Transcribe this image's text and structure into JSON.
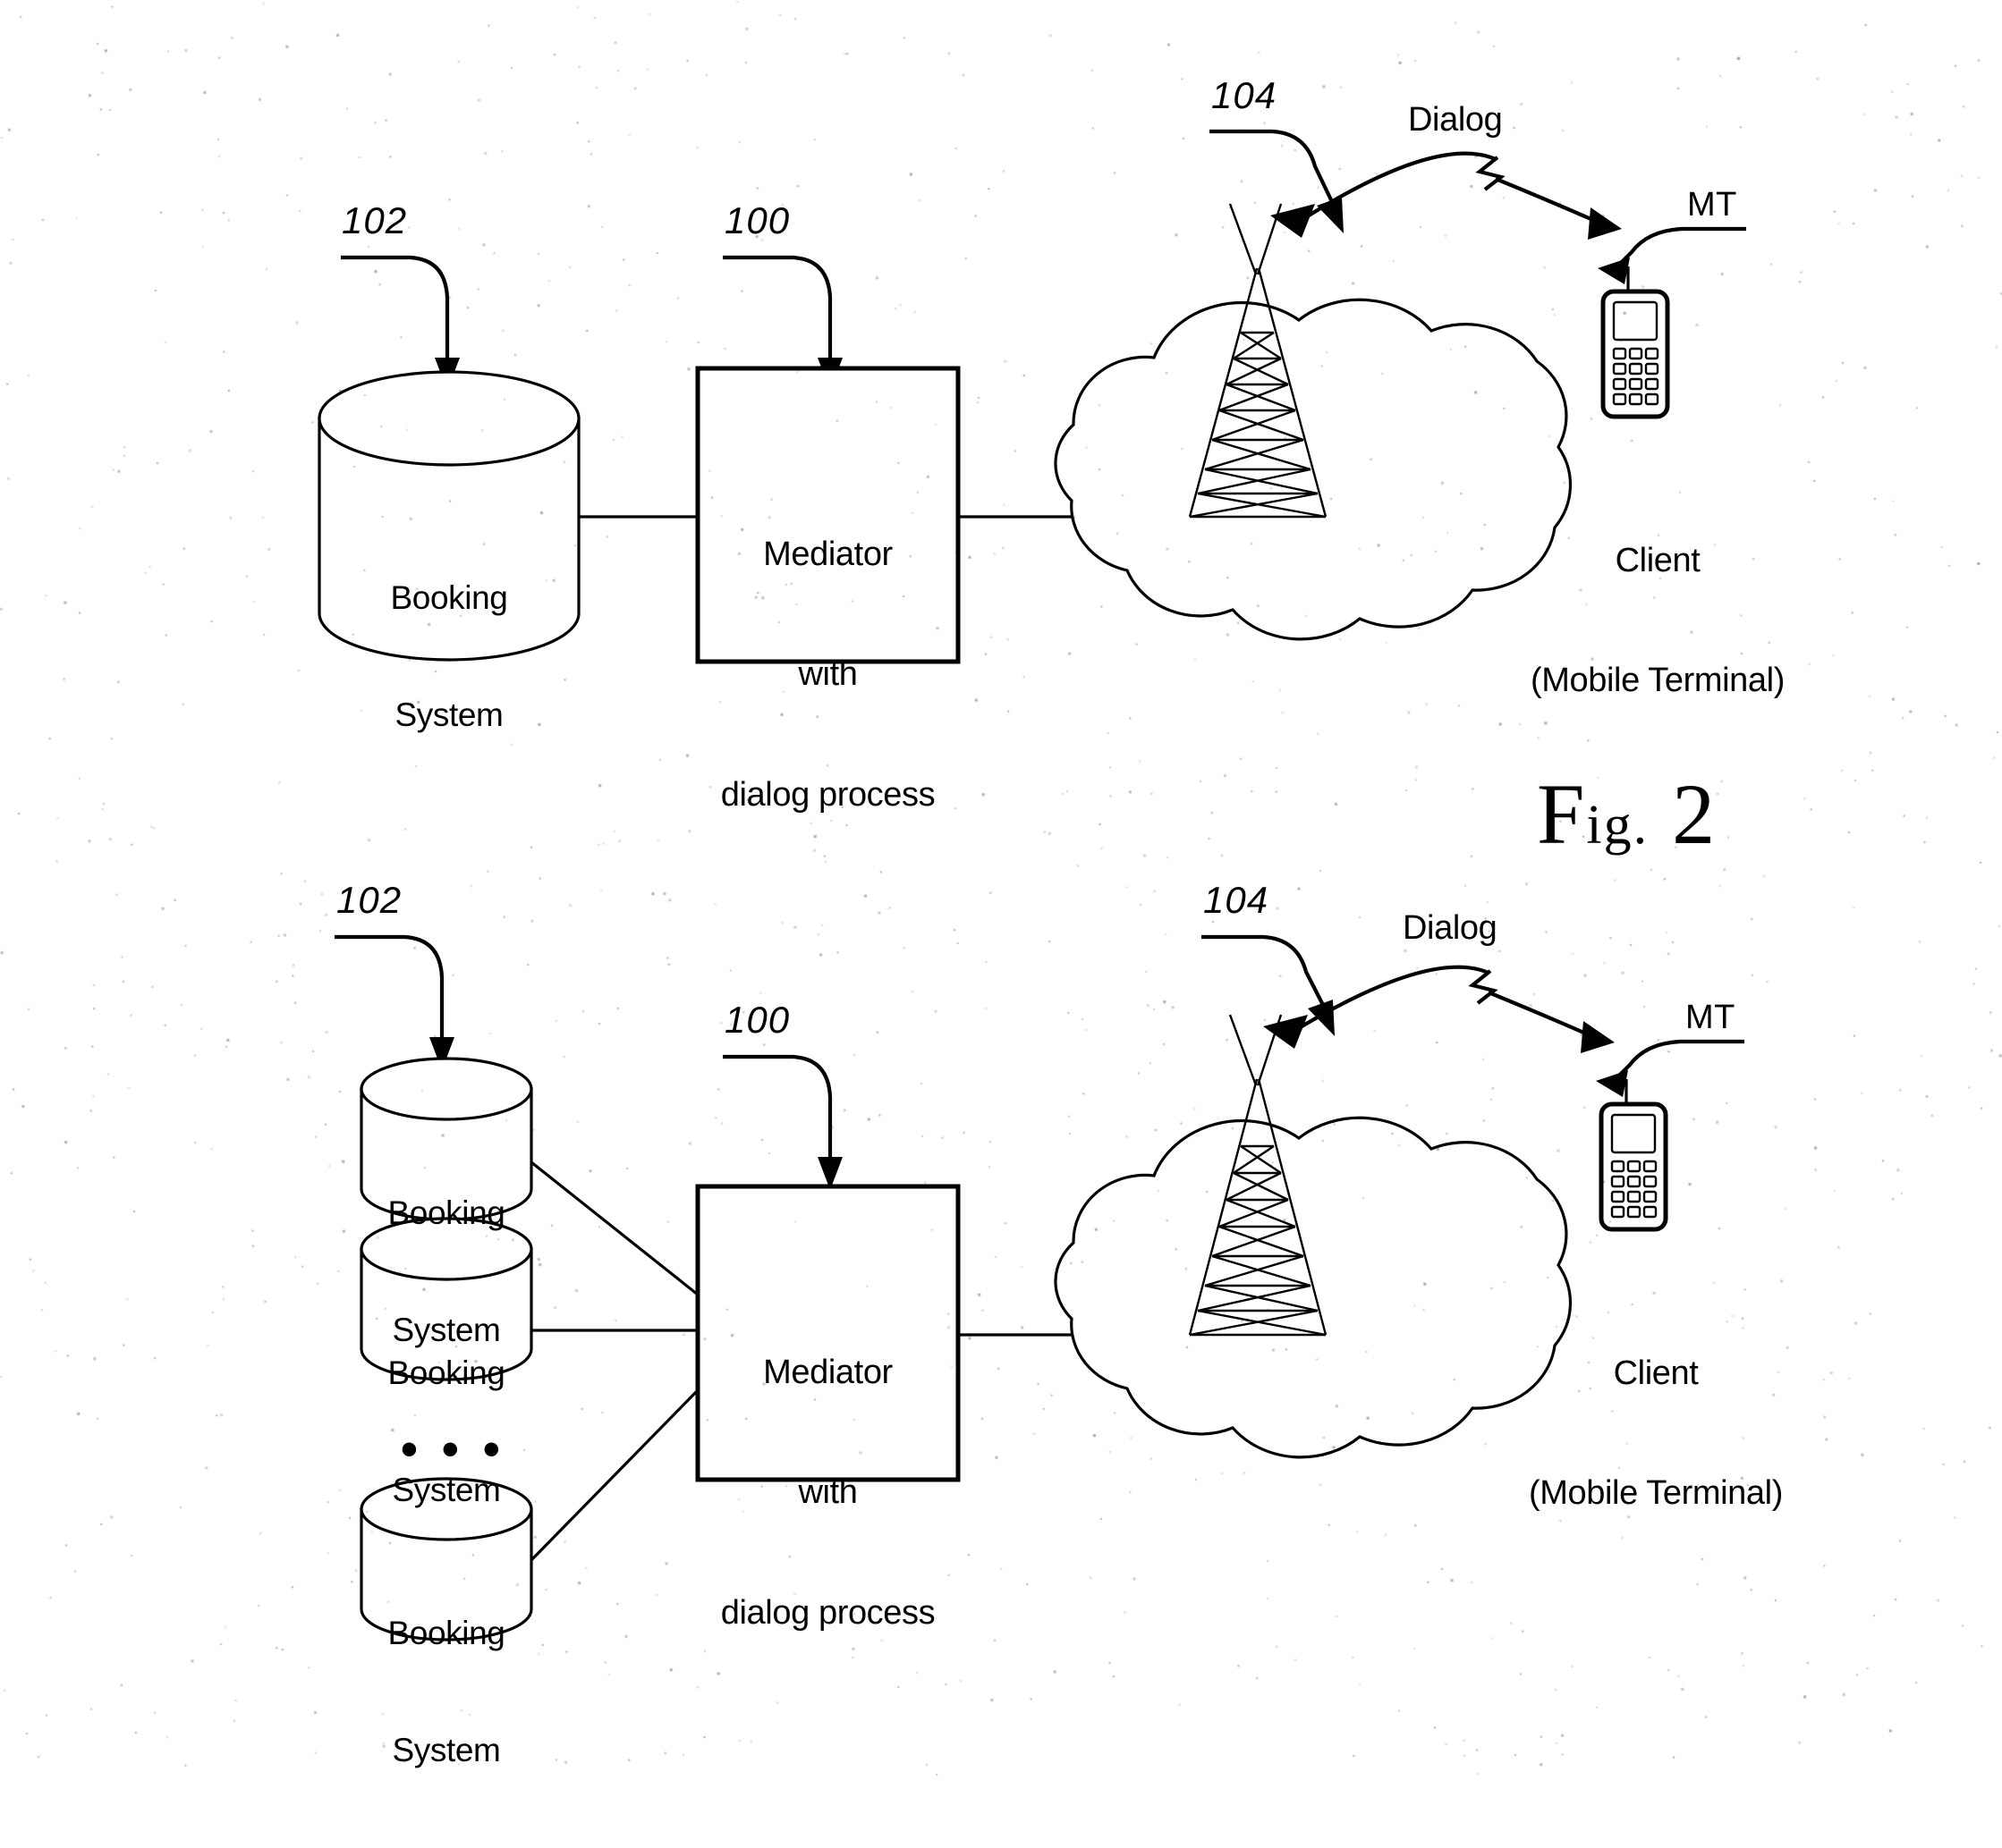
{
  "figure": {
    "caption_main": "F",
    "caption_small": "ig",
    "caption_dot": ".",
    "caption_number": "2",
    "caption_full": "Fig. 2"
  },
  "diagram_top": {
    "refs": {
      "booking_ref": "102",
      "mediator_ref": "100",
      "network_ref": "104"
    },
    "booking_system": {
      "line1": "Booking",
      "line2": "System"
    },
    "mediator": {
      "line1": "Mediator",
      "line2": "with",
      "line3": "dialog process"
    },
    "network": {
      "icon": "cloud-with-antenna-tower"
    },
    "dialog_label": "Dialog",
    "mt_label": "MT",
    "client": {
      "line1": "Client",
      "line2": "(Mobile Terminal)"
    }
  },
  "diagram_bottom": {
    "refs": {
      "booking_ref": "102",
      "mediator_ref": "100",
      "network_ref": "104"
    },
    "booking_systems": [
      {
        "line1": "Booking",
        "line2": "System"
      },
      {
        "line1": "Booking",
        "line2": "System"
      },
      {
        "line1": "Booking",
        "line2": "System"
      }
    ],
    "ellipsis": "• • •",
    "mediator": {
      "line1": "Mediator",
      "line2": "with",
      "line3": "dialog process"
    },
    "network": {
      "icon": "cloud-with-antenna-tower"
    },
    "dialog_label": "Dialog",
    "mt_label": "MT",
    "client": {
      "line1": "Client",
      "line2": "(Mobile Terminal)"
    }
  },
  "colors": {
    "ink": "#000000",
    "paper": "#ffffff"
  }
}
